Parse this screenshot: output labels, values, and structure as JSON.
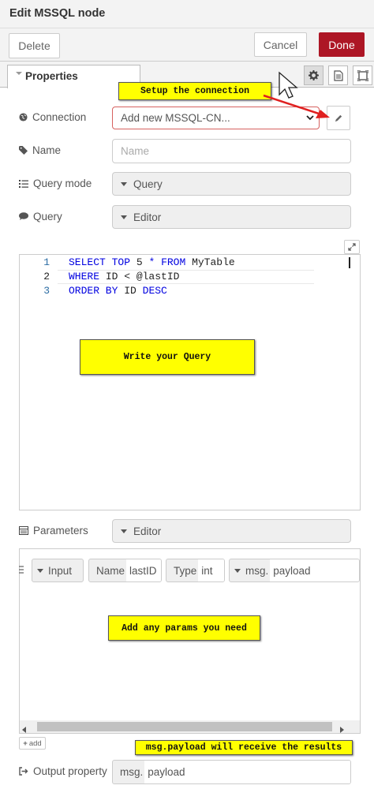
{
  "header": {
    "title": "Edit MSSQL node"
  },
  "toolbar": {
    "delete_label": "Delete",
    "cancel_label": "Cancel",
    "done_label": "Done"
  },
  "tabs": {
    "properties_label": "Properties"
  },
  "form": {
    "connection": {
      "label": "Connection",
      "value": "Add new MSSQL-CN..."
    },
    "name": {
      "label": "Name",
      "placeholder": "Name"
    },
    "query_mode": {
      "label": "Query mode",
      "value": "Query"
    },
    "query": {
      "label": "Query",
      "value": "Editor"
    },
    "parameters": {
      "label": "Parameters",
      "value": "Editor"
    },
    "output": {
      "label": "Output property",
      "prefix": "msg.",
      "value": "payload"
    }
  },
  "editor": {
    "lines": [
      {
        "no": "1",
        "parts": [
          [
            "kw",
            "SELECT"
          ],
          [
            "",
            " "
          ],
          [
            "kw",
            "TOP"
          ],
          [
            "",
            " 5 "
          ],
          [
            "kw",
            "*"
          ],
          [
            "",
            " "
          ],
          [
            "kw",
            "FROM"
          ],
          [
            "",
            " MyTable"
          ]
        ]
      },
      {
        "no": "2",
        "parts": [
          [
            "kw",
            "WHERE"
          ],
          [
            "",
            " ID < @lastID"
          ]
        ]
      },
      {
        "no": "3",
        "parts": [
          [
            "kw",
            "ORDER BY"
          ],
          [
            "",
            " ID "
          ],
          [
            "kw",
            "DESC"
          ]
        ]
      }
    ]
  },
  "param_row": {
    "direction": "Input",
    "name_label": "Name",
    "name_value": "lastID",
    "type_label": "Type",
    "type_value": "int",
    "source_prefix": "msg.",
    "source_value": "payload"
  },
  "add_button_label": "add",
  "annotations": {
    "setup": "Setup the connection",
    "query": "Write your Query",
    "params": "Add any params you need",
    "results": "msg.payload will receive the results"
  },
  "colors": {
    "primary": "#ad1625",
    "annotation": "#ffff00",
    "keyword": "#0000e0"
  }
}
